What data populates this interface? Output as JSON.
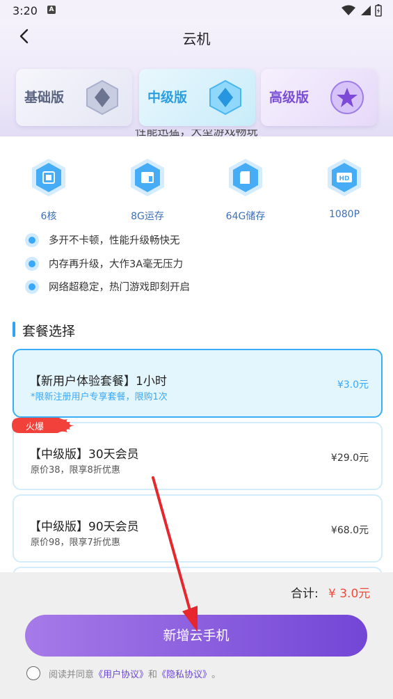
{
  "status_bar": {
    "time": "3:20",
    "notification_badge": "A"
  },
  "header": {
    "title": "云机"
  },
  "tiers": [
    {
      "label": "基础版",
      "color": "#5a6480"
    },
    {
      "label": "中级版",
      "color": "#2d9fe0"
    },
    {
      "label": "高级版",
      "color": "#7a4fd6"
    }
  ],
  "cut_text": "性能迅猛，大型游戏畅玩",
  "features": [
    {
      "icon": "cpu-icon",
      "label": "6核"
    },
    {
      "icon": "memory-icon",
      "label": "8G运存"
    },
    {
      "icon": "sd-card-icon",
      "label": "64G储存"
    },
    {
      "icon": "hd-icon",
      "label": "1080P"
    }
  ],
  "benefits": [
    "多开不卡顿，性能升级畅快无",
    "内存再升级，大作3A毫无压力",
    "网络超稳定，热门游戏即刻开启"
  ],
  "section": {
    "title": "套餐选择"
  },
  "plans": [
    {
      "name": "【新用户体验套餐】1小时",
      "note": "*限新注册用户专享套餐，限购1次",
      "price": "¥3.0元",
      "selected": true
    },
    {
      "name": "【中级版】30天会员",
      "note": "原价38，限享8折优惠",
      "price": "¥29.0元",
      "badge": "火爆"
    },
    {
      "name": "【中级版】90天会员",
      "note": "原价98，限享7折优惠",
      "price": "¥68.0元"
    }
  ],
  "footer": {
    "total_label": "合计:",
    "total_value": "¥ 3.0元",
    "cta_label": "新增云手机",
    "agree_prefix": "阅读并同意",
    "user_agreement": "《用户协议》",
    "and": "和",
    "privacy_agreement": "《隐私协议》",
    "suffix": "。"
  },
  "colors": {
    "accent": "#3aa8f8",
    "cta_start": "#a67ae8",
    "cta_end": "#7346d6",
    "price_total": "#f04b3a",
    "annotation_arrow": "#e8262e"
  }
}
